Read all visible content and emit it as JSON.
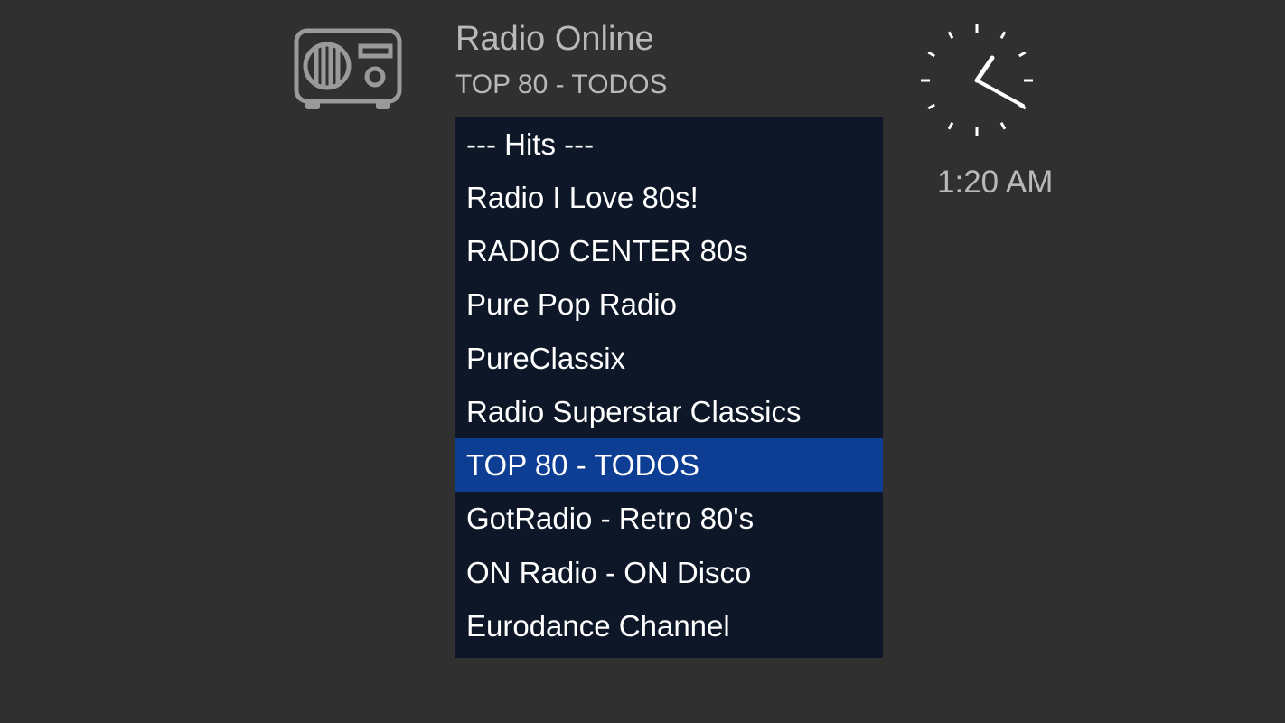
{
  "header": {
    "title": "Radio Online",
    "subtitle": "TOP 80 - TODOS",
    "icon": "radio-icon"
  },
  "clock": {
    "icon": "analog-clock-icon",
    "time": "1:20 AM"
  },
  "stations": [
    {
      "label": "--- Hits ---",
      "selected": false
    },
    {
      "label": "Radio I Love 80s!",
      "selected": false
    },
    {
      "label": "RADIO CENTER 80s",
      "selected": false
    },
    {
      "label": "Pure Pop Radio",
      "selected": false
    },
    {
      "label": "PureClassix",
      "selected": false
    },
    {
      "label": "Radio Superstar Classics",
      "selected": false
    },
    {
      "label": "TOP 80 - TODOS",
      "selected": true
    },
    {
      "label": "GotRadio - Retro 80's",
      "selected": false
    },
    {
      "label": "ON Radio - ON Disco",
      "selected": false
    },
    {
      "label": "Eurodance Channel",
      "selected": false
    }
  ],
  "colors": {
    "background": "#303030",
    "list_background": "#0d1727",
    "selected_background": "#0e3e93",
    "header_text": "#b9b9b9",
    "list_text": "#ffffff"
  }
}
